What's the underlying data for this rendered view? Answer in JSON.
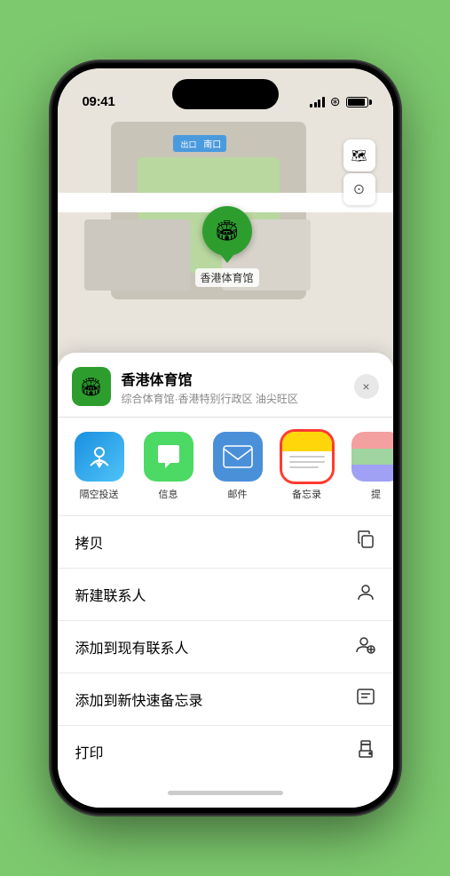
{
  "statusBar": {
    "time": "09:41",
    "location_arrow": "▶"
  },
  "map": {
    "south_entrance_label": "南口",
    "venue_pin_label": "香港体育馆",
    "map_type_icon": "🗺",
    "location_icon": "⊙"
  },
  "sheet": {
    "venue_name": "香港体育馆",
    "venue_subtitle": "综合体育馆·香港特别行政区 油尖旺区",
    "close_label": "×",
    "venue_emoji": "🏟"
  },
  "shareApps": [
    {
      "id": "airdrop",
      "label": "隔空投送",
      "type": "airdrop"
    },
    {
      "id": "messages",
      "label": "信息",
      "type": "messages"
    },
    {
      "id": "mail",
      "label": "邮件",
      "type": "mail"
    },
    {
      "id": "notes",
      "label": "备忘录",
      "type": "notes",
      "highlighted": true
    },
    {
      "id": "more",
      "label": "提",
      "type": "more"
    }
  ],
  "actions": [
    {
      "id": "copy",
      "label": "拷贝",
      "icon": "copy"
    },
    {
      "id": "new-contact",
      "label": "新建联系人",
      "icon": "person"
    },
    {
      "id": "add-existing",
      "label": "添加到现有联系人",
      "icon": "person-add"
    },
    {
      "id": "add-note",
      "label": "添加到新快速备忘录",
      "icon": "note"
    },
    {
      "id": "print",
      "label": "打印",
      "icon": "print"
    }
  ]
}
